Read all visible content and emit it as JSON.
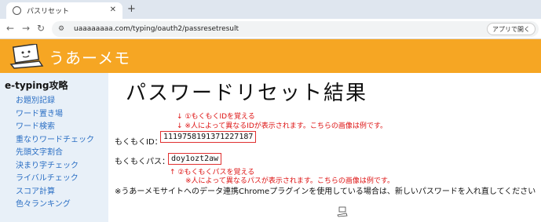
{
  "browser": {
    "tab_title": "パスリセット",
    "tab_close": "✕",
    "new_tab": "+",
    "url": "uaaaaaaaa.com/typing/oauth2/passresetresult",
    "app_button": "アプリで開く",
    "back_icon": "←",
    "forward_icon": "→",
    "reload_icon": "↻"
  },
  "header": {
    "brand": "うあーメモ",
    "color": "#f6a623"
  },
  "sidebar": {
    "title": "e-typing攻略",
    "items": [
      "お題別記録",
      "ワード置き場",
      "ワード検索",
      "重なりワードチェック",
      "先頭文字割合",
      "決まり字チェック",
      "ライバルチェック",
      "スコア計算",
      "色々ランキング"
    ]
  },
  "main": {
    "title": "パスワードリセット結果",
    "note_id_1": "↓ ①もくもくIDを覚える",
    "note_id_2": "↓ ※人によって異なるIDが表示されます。こちらの画像は例です。",
    "id_label": "もくもくID：",
    "id_value": "1119758191371227187",
    "pass_label": "もくもくパス：",
    "pass_value": "doy1ozt2aw",
    "note_pass_1": "↑ ②もくもくパスを覚える",
    "note_pass_2": "※人によって異なるパスが表示されます。こちらの画像は例です。",
    "footer": "※うあーメモサイトへのデータ連携Chromeプラグインを使用している場合は、新しいパスワードを入れ直してください"
  }
}
